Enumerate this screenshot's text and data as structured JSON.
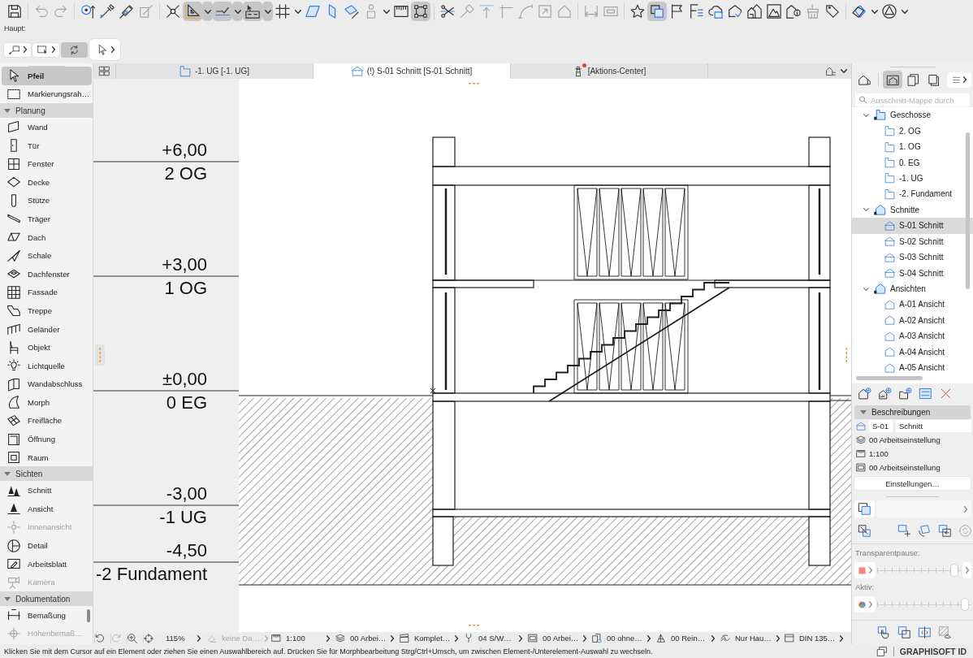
{
  "toolbar": {
    "groups": [
      [
        {
          "pressed": false,
          "menu": false,
          "disabled": false
        }
      ],
      [
        {
          "pressed": false,
          "menu": false,
          "disabled": true
        },
        {
          "pressed": false,
          "menu": false,
          "disabled": true
        }
      ],
      [
        {
          "pressed": false,
          "menu": false,
          "disabled": false
        },
        {
          "pressed": false,
          "menu": false,
          "disabled": false
        },
        {
          "pressed": false,
          "menu": false,
          "disabled": false
        },
        {
          "pressed": false,
          "menu": false,
          "disabled": true
        }
      ],
      [
        {
          "pressed": false,
          "menu": false,
          "disabled": false
        },
        {
          "pressed": true,
          "menu": true,
          "disabled": false
        },
        {
          "pressed": true,
          "menu": true,
          "disabled": false
        },
        {
          "pressed": true,
          "menu": true,
          "disabled": false
        },
        {
          "pressed": false,
          "menu": true,
          "disabled": false
        },
        {
          "pressed": false,
          "menu": false,
          "disabled": false
        },
        {
          "pressed": false,
          "menu": false,
          "disabled": false
        },
        {
          "pressed": false,
          "menu": false,
          "disabled": false
        },
        {
          "pressed": false,
          "menu": true,
          "disabled": false
        },
        {
          "pressed": false,
          "menu": false,
          "disabled": false
        },
        {
          "pressed": true,
          "menu": false,
          "disabled": false
        }
      ],
      [
        {
          "pressed": false,
          "menu": false,
          "disabled": false
        },
        {
          "pressed": false,
          "menu": false,
          "disabled": true
        },
        {
          "pressed": false,
          "menu": false,
          "disabled": true
        },
        {
          "pressed": false,
          "menu": false,
          "disabled": true
        },
        {
          "pressed": false,
          "menu": false,
          "disabled": true
        },
        {
          "pressed": false,
          "menu": false,
          "disabled": true
        },
        {
          "pressed": false,
          "menu": false,
          "disabled": true
        }
      ],
      [
        {
          "pressed": false,
          "menu": false,
          "disabled": true
        },
        {
          "pressed": false,
          "menu": false,
          "disabled": true
        }
      ],
      [
        {
          "pressed": false,
          "menu": false,
          "disabled": false
        },
        {
          "pressed": true,
          "menu": false,
          "disabled": false
        },
        {
          "pressed": false,
          "menu": false,
          "disabled": false
        },
        {
          "pressed": false,
          "menu": false,
          "disabled": false
        },
        {
          "pressed": false,
          "menu": false,
          "disabled": false
        },
        {
          "pressed": false,
          "menu": false,
          "disabled": false
        },
        {
          "pressed": false,
          "menu": false,
          "disabled": false
        },
        {
          "pressed": false,
          "menu": false,
          "disabled": false
        },
        {
          "pressed": false,
          "menu": false,
          "disabled": false
        },
        {
          "pressed": false,
          "menu": false,
          "disabled": true
        },
        {
          "pressed": false,
          "menu": false,
          "disabled": false
        }
      ],
      [
        {
          "pressed": false,
          "menu": true,
          "disabled": false
        },
        {
          "pressed": false,
          "menu": true,
          "disabled": false
        }
      ]
    ]
  },
  "toolbar_2": {
    "label": "Haupt:",
    "buttons": [
      {
        "pressed": false,
        "menu": true
      },
      {
        "pressed": false,
        "menu": true
      },
      {
        "pressed": true,
        "menu": false
      },
      {
        "pressed": false,
        "menu": true
      }
    ]
  },
  "toolbox": {
    "tools": [
      {
        "label": "Pfeil",
        "selected": true,
        "disabled": false
      },
      {
        "label": "Markierungsrah…",
        "selected": false,
        "disabled": false
      }
    ],
    "sections": [
      {
        "title": "Planung",
        "expanded": true,
        "tools": [
          {
            "label": "Wand",
            "selected": false,
            "disabled": false
          },
          {
            "label": "Tür",
            "selected": false,
            "disabled": false
          },
          {
            "label": "Fenster",
            "selected": false,
            "disabled": false
          },
          {
            "label": "Decke",
            "selected": false,
            "disabled": false
          },
          {
            "label": "Stütze",
            "selected": false,
            "disabled": false
          },
          {
            "label": "Träger",
            "selected": false,
            "disabled": false
          },
          {
            "label": "Dach",
            "selected": false,
            "disabled": false
          },
          {
            "label": "Schale",
            "selected": false,
            "disabled": false
          },
          {
            "label": "Dachfenster",
            "selected": false,
            "disabled": false
          },
          {
            "label": "Fassade",
            "selected": false,
            "disabled": false
          },
          {
            "label": "Treppe",
            "selected": false,
            "disabled": false
          },
          {
            "label": "Geländer",
            "selected": false,
            "disabled": false
          },
          {
            "label": "Objekt",
            "selected": false,
            "disabled": false
          },
          {
            "label": "Lichtquelle",
            "selected": false,
            "disabled": false
          },
          {
            "label": "Wandabschluss",
            "selected": false,
            "disabled": false
          },
          {
            "label": "Morph",
            "selected": false,
            "disabled": false
          },
          {
            "label": "Freifläche",
            "selected": false,
            "disabled": false
          },
          {
            "label": "Öffnung",
            "selected": false,
            "disabled": false
          },
          {
            "label": "Raum",
            "selected": false,
            "disabled": false
          }
        ]
      },
      {
        "title": "Sichten",
        "expanded": true,
        "tools": [
          {
            "label": "Schnitt",
            "selected": false,
            "disabled": false
          },
          {
            "label": "Ansicht",
            "selected": false,
            "disabled": false
          },
          {
            "label": "Innenansicht",
            "selected": false,
            "disabled": true
          },
          {
            "label": "Detail",
            "selected": false,
            "disabled": false
          },
          {
            "label": "Arbeitsblatt",
            "selected": false,
            "disabled": false
          },
          {
            "label": "Kamera",
            "selected": false,
            "disabled": true
          }
        ]
      },
      {
        "title": "Dokumentation",
        "expanded": true,
        "tools": [
          {
            "label": "Bemaßung",
            "selected": false,
            "disabled": false
          },
          {
            "label": "Höhenbemaß…",
            "selected": false,
            "disabled": true
          }
        ]
      }
    ]
  },
  "tabs": [
    {
      "label": "-1. UG [-1. UG]",
      "kind": "floor",
      "selected": false,
      "alert": false
    },
    {
      "label": "(!) S-01 Schnitt [S-01 Schnitt]",
      "kind": "section",
      "selected": true,
      "alert": false
    },
    {
      "label": "[Aktions-Center]",
      "kind": "actions",
      "selected": false,
      "alert": true
    }
  ],
  "canvas": {
    "levels": [
      {
        "elevation": "+6,00",
        "name": "2 OG"
      },
      {
        "elevation": "+3,00",
        "name": "1 OG"
      },
      {
        "elevation": "±0,00",
        "name": "0 EG"
      },
      {
        "elevation": "-3,00",
        "name": "-1 UG"
      },
      {
        "elevation": "-4,50",
        "name": "-2 Fundament"
      }
    ]
  },
  "status_bar": {
    "zoom": "115%",
    "items": [
      {
        "label": "keine Da…",
        "disabled": true
      },
      {
        "label": "1:100",
        "disabled": false
      },
      {
        "label": "00 Arbei…",
        "disabled": false
      },
      {
        "label": "Komplet…",
        "disabled": false
      },
      {
        "label": "04 S/W…",
        "disabled": false
      },
      {
        "label": "00 Arbei…",
        "disabled": false
      },
      {
        "label": "00 ohne…",
        "disabled": false
      },
      {
        "label": "00 Rein…",
        "disabled": false
      },
      {
        "label": "Nur Hau…",
        "disabled": false
      },
      {
        "label": "DIN 135…",
        "disabled": false
      }
    ]
  },
  "navigator": {
    "views": [
      {
        "selected": false
      },
      {
        "selected": true
      },
      {
        "selected": false
      },
      {
        "selected": false
      }
    ],
    "search": {
      "placeholder": "Ausschnitt-Mappe durch"
    },
    "tree": [
      {
        "label": "Geschosse",
        "kind": "floors",
        "expanded": true,
        "selected": false,
        "children": [
          {
            "label": "2. OG",
            "kind": "floor",
            "selected": false
          },
          {
            "label": "1. OG",
            "kind": "floor",
            "selected": false
          },
          {
            "label": "0. EG",
            "kind": "floor",
            "selected": false
          },
          {
            "label": "-1. UG",
            "kind": "floor",
            "selected": false
          },
          {
            "label": "-2. Fundament",
            "kind": "floor",
            "selected": false
          }
        ]
      },
      {
        "label": "Schnitte",
        "kind": "sections",
        "expanded": true,
        "selected": false,
        "children": [
          {
            "label": "S-01 Schnitt",
            "kind": "section",
            "selected": true
          },
          {
            "label": "S-02 Schnitt",
            "kind": "section",
            "selected": false
          },
          {
            "label": "S-03 Schnitt",
            "kind": "section",
            "selected": false
          },
          {
            "label": "S-04 Schnitt",
            "kind": "section",
            "selected": false
          }
        ]
      },
      {
        "label": "Ansichten",
        "kind": "elevations",
        "expanded": true,
        "selected": false,
        "children": [
          {
            "label": "A-01 Ansicht",
            "kind": "elevation",
            "selected": false
          },
          {
            "label": "A-02 Ansicht",
            "kind": "elevation",
            "selected": false
          },
          {
            "label": "A-03 Ansicht",
            "kind": "elevation",
            "selected": false
          },
          {
            "label": "A-04 Ansicht",
            "kind": "elevation",
            "selected": false
          },
          {
            "label": "A-05 Ansicht",
            "kind": "elevation",
            "selected": false
          }
        ]
      }
    ]
  },
  "properties": {
    "title": "Beschreibungen",
    "expanded": true,
    "reference": "S-01",
    "name": "Schnitt",
    "rows": [
      {
        "text": "00 Arbeitseinstellung"
      },
      {
        "text": "1:100"
      },
      {
        "text": "00 Arbeitseinstellung"
      }
    ],
    "settings_button": "Einstellungen…"
  },
  "sliders": [
    {
      "label": "Transparentpause:",
      "level": 0.96,
      "menu": true
    },
    {
      "label": "Aktiv:",
      "level": 0.96,
      "menu": false
    }
  ],
  "hint": "Klicken Sie mit dem Cursor auf ein Element oder ziehen Sie einen Auswahlbereich auf. Drücken Sie für Morphbearbeitung Strg/Ctrl+Umsch, um zwischen Element-/Unterelement-Auswahl zu wechseln.",
  "footer": {
    "account": "GRAPHISOFT ID"
  }
}
